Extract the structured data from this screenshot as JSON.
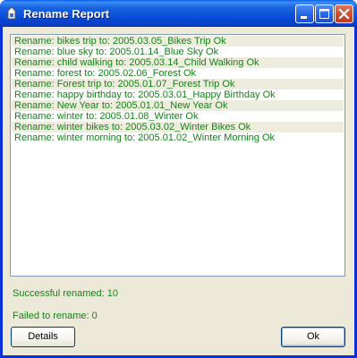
{
  "window": {
    "title": "Rename Report",
    "controls": {
      "minimize": "minimize-icon",
      "maximize": "maximize-icon",
      "close": "close-icon"
    }
  },
  "report": {
    "lines": [
      "Rename: bikes trip to: 2005.03.05_Bikes Trip Ok",
      "Rename: blue sky to: 2005.01.14_Blue Sky Ok",
      "Rename: child walking to: 2005.03.14_Child Walking Ok",
      "Rename: forest to: 2005.02.06_Forest Ok",
      "Rename: Forest trip to: 2005.01.07_Forest Trip Ok",
      "Rename: happy  birthday to: 2005.03.01_Happy  Birthday Ok",
      "Rename: New Year to: 2005.01.01_New Year Ok",
      "Rename: winter to: 2005.01.08_Winter Ok",
      "Rename: winter bikes to: 2005.03.02_Winter Bikes Ok",
      "Rename: winter morning to: 2005.01.02_Winter Morning Ok"
    ]
  },
  "summary": {
    "success": "Successful renamed: 10",
    "failed": "Failed to rename: 0"
  },
  "buttons": {
    "details": "Details",
    "ok": "Ok"
  },
  "colors": {
    "title_bar": "#0848d6",
    "report_text": "#18801c",
    "alt_row": "#eeeddd",
    "dialog_face": "#ece9d8"
  }
}
